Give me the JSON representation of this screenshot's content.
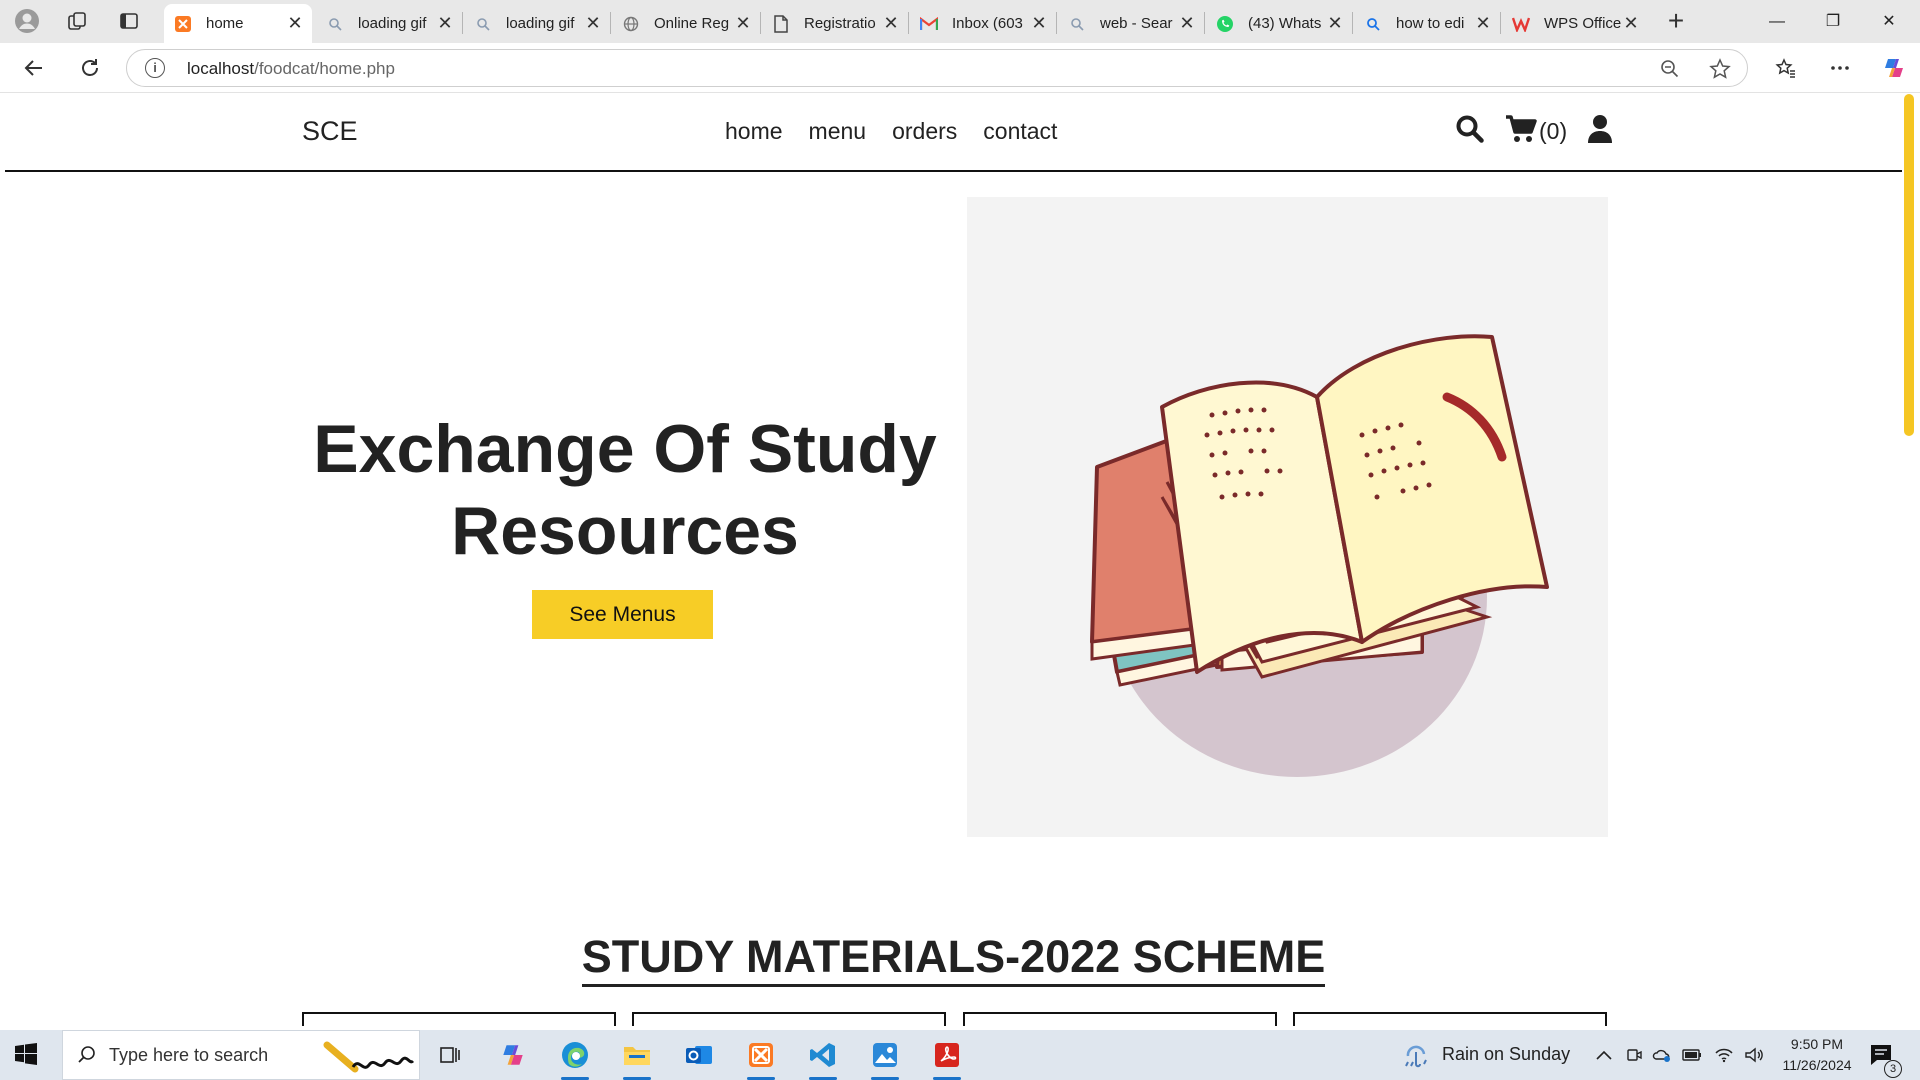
{
  "browser": {
    "tabs": [
      {
        "title": "home",
        "active": true,
        "icon": "xampp-icon"
      },
      {
        "title": "loading gif",
        "active": false,
        "icon": "search-icon"
      },
      {
        "title": "loading gif",
        "active": false,
        "icon": "search-icon"
      },
      {
        "title": "Online Reg",
        "active": false,
        "icon": "globe-icon"
      },
      {
        "title": "Registratio",
        "active": false,
        "icon": "document-icon"
      },
      {
        "title": "Inbox (603",
        "active": false,
        "icon": "gmail-icon"
      },
      {
        "title": "web - Sear",
        "active": false,
        "icon": "search-icon"
      },
      {
        "title": "(43) Whats",
        "active": false,
        "icon": "whatsapp-icon"
      },
      {
        "title": "how to edi",
        "active": false,
        "icon": "search-icon"
      },
      {
        "title": "WPS Office",
        "active": false,
        "icon": "wps-icon"
      }
    ],
    "address": {
      "host": "localhost",
      "path": "/foodcat/home.php"
    }
  },
  "site": {
    "logo": "SCE",
    "nav": [
      "home",
      "menu",
      "orders",
      "contact"
    ],
    "cart_count": "(0)",
    "hero": {
      "title_line1": "Exchange Of Study",
      "title_line2": "Resources",
      "button": "See Menus"
    },
    "section_title": "STUDY MATERIALS-2022 SCHEME",
    "accent_color": "#f7cd26"
  },
  "taskbar": {
    "search_placeholder": "Type here to search",
    "weather": "Rain on Sunday",
    "time": "9:50 PM",
    "date": "11/26/2024",
    "notification_count": "3"
  }
}
